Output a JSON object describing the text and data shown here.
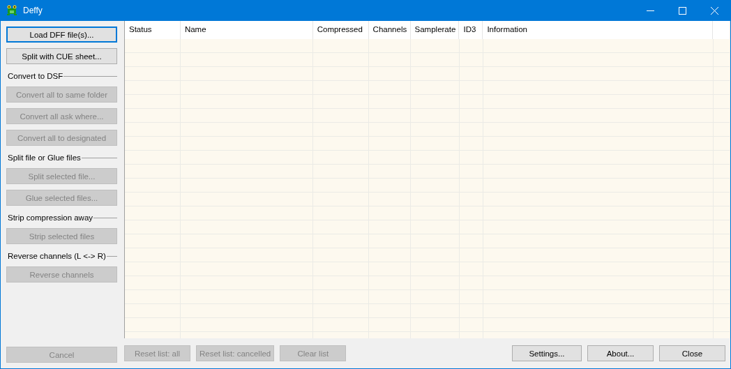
{
  "window": {
    "title": "Deffy"
  },
  "side_panel": [
    {
      "kind": "button",
      "label": "Load DFF file(s)...",
      "disabled": false,
      "focused": true
    },
    {
      "kind": "button",
      "label": "Split with CUE sheet...",
      "disabled": false,
      "focused": false
    },
    {
      "kind": "section",
      "label": "Convert to DSF"
    },
    {
      "kind": "button",
      "label": "Convert all to same folder",
      "disabled": true,
      "focused": false
    },
    {
      "kind": "button",
      "label": "Convert all ask where...",
      "disabled": true,
      "focused": false
    },
    {
      "kind": "button",
      "label": "Convert all to designated",
      "disabled": true,
      "focused": false
    },
    {
      "kind": "section",
      "label": "Split file or Glue files"
    },
    {
      "kind": "button",
      "label": "Split selected file...",
      "disabled": true,
      "focused": false
    },
    {
      "kind": "button",
      "label": "Glue selected files...",
      "disabled": true,
      "focused": false
    },
    {
      "kind": "section",
      "label": "Strip compression away"
    },
    {
      "kind": "button",
      "label": "Strip selected files",
      "disabled": true,
      "focused": false
    },
    {
      "kind": "section",
      "label": "Reverse channels (L <-> R)"
    },
    {
      "kind": "button",
      "label": "Reverse channels",
      "disabled": true,
      "focused": false
    }
  ],
  "cancel_button": {
    "label": "Cancel",
    "disabled": true
  },
  "table": {
    "columns": [
      "Status",
      "Name",
      "Compressed",
      "Channels",
      "Samplerate",
      "ID3",
      "Information"
    ]
  },
  "bottom_left_buttons": [
    {
      "label": "Reset list: all",
      "disabled": true
    },
    {
      "label": "Reset list: cancelled",
      "disabled": true
    },
    {
      "label": "Clear list",
      "disabled": true
    }
  ],
  "bottom_right_buttons": [
    {
      "label": "Settings...",
      "disabled": false
    },
    {
      "label": "About...",
      "disabled": false
    },
    {
      "label": "Close",
      "disabled": false
    }
  ]
}
